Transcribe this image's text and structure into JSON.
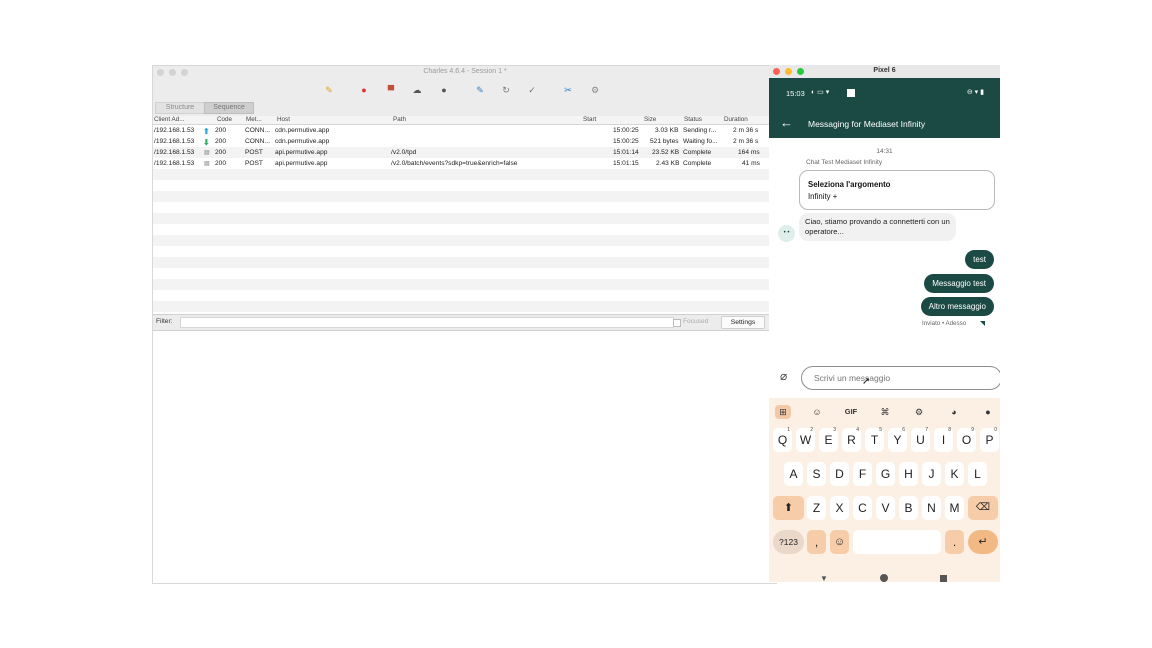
{
  "charles": {
    "title": "Charles 4.6.4 - Session 1 *",
    "view_tabs": [
      "Structure",
      "Sequence"
    ],
    "columns": [
      "Client Ad...",
      "Code",
      "Met...",
      "Host",
      "Path",
      "Start",
      "Size",
      "Status",
      "Duration"
    ],
    "rows": [
      {
        "client": "/192.168.1.53",
        "direction": "up",
        "code": "200",
        "method": "CONN...",
        "host": "cdn.permutive.app",
        "path": "",
        "start": "15:00:25",
        "size": "3.03 KB",
        "status": "Sending r...",
        "duration": "2 m 36 s"
      },
      {
        "client": "/192.168.1.53",
        "direction": "down",
        "code": "200",
        "method": "CONN...",
        "host": "cdn.permutive.app",
        "path": "",
        "start": "15:00:25",
        "size": "521 bytes",
        "status": "Waiting fo...",
        "duration": "2 m 36 s"
      },
      {
        "client": "/192.168.1.53",
        "direction": "none",
        "code": "200",
        "method": "POST",
        "host": "api.permutive.app",
        "path": "/v2.0/tpd",
        "start": "15:01:14",
        "size": "23.52 KB",
        "status": "Complete",
        "duration": "164 ms"
      },
      {
        "client": "/192.168.1.53",
        "direction": "none",
        "code": "200",
        "method": "POST",
        "host": "api.permutive.app",
        "path": "/v2.0/batch/events?sdkp=true&enrich=false",
        "start": "15:01:15",
        "size": "2.43 KB",
        "status": "Complete",
        "duration": "41 ms"
      }
    ],
    "filter_label": "Filter:",
    "filter_value": "",
    "focused_label": "Focused",
    "settings_label": "Settings"
  },
  "emulator": {
    "window_title": "Pixel 6",
    "status_time": "15:03",
    "app_title": "Messaging for Mediaset Infinity",
    "chat": {
      "timestamp": "14:31",
      "sender": "Chat Test Mediaset Infinity",
      "topic_title": "Seleziona l'argomento",
      "topic_value": "Infinity +",
      "bot_message": "Ciao, stiamo provando a connetterti con un operatore...",
      "outgoing": [
        "test",
        "Messaggio test",
        "Altro messaggio"
      ],
      "delivery_status": "Inviato • Adesso"
    },
    "input_placeholder": "Scrivi un messaggio",
    "keyboard": {
      "suggestions": [
        "apps-icon",
        "sticker-icon",
        "GIF",
        "translate-icon",
        "gear-icon",
        "palette-icon",
        "mic-icon"
      ],
      "row1": [
        "Q",
        "W",
        "E",
        "R",
        "T",
        "Y",
        "U",
        "I",
        "O",
        "P"
      ],
      "row1_digits": [
        "1",
        "2",
        "3",
        "4",
        "5",
        "6",
        "7",
        "8",
        "9",
        "0"
      ],
      "row2": [
        "A",
        "S",
        "D",
        "F",
        "G",
        "H",
        "J",
        "K",
        "L"
      ],
      "row3": [
        "Z",
        "X",
        "C",
        "V",
        "B",
        "N",
        "M"
      ],
      "symbols_label": "?123",
      "comma": ",",
      "period": "."
    }
  },
  "colors": {
    "accent": "#1b4a45",
    "keyboard_bg": "#fcefe4",
    "key_active": "#f7cda9",
    "upload_arrow": "#2aa7d6",
    "download_arrow": "#35b36a"
  }
}
